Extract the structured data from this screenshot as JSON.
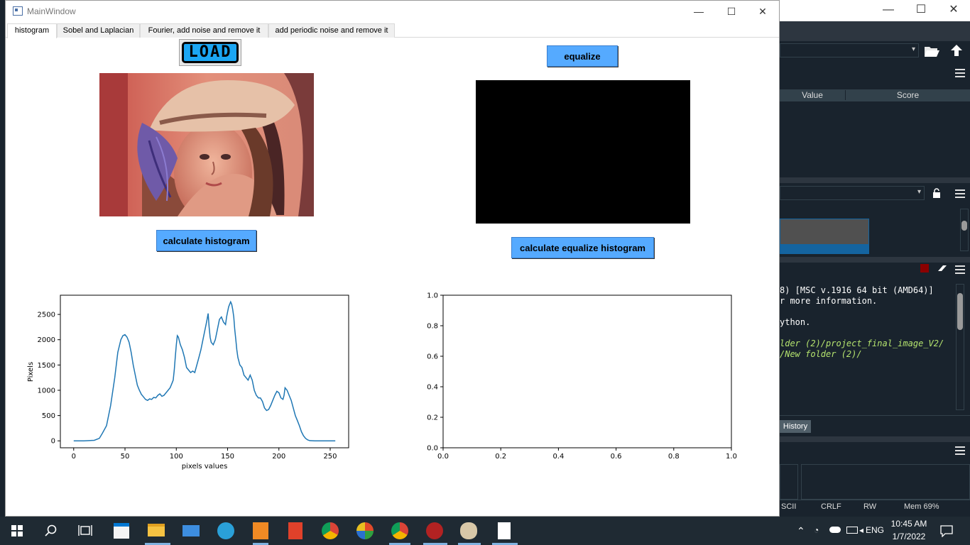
{
  "window": {
    "title": "MainWindow",
    "minimize": "—",
    "maximize": "☐",
    "close": "✕"
  },
  "tabs": [
    {
      "label": "histogram",
      "active": true
    },
    {
      "label": "Sobel and Laplacian",
      "active": false
    },
    {
      "label": "Fourier, add noise and remove it",
      "active": false
    },
    {
      "label": "add periodic noise and remove it",
      "active": false
    }
  ],
  "buttons": {
    "load": "LOAD",
    "equalize": "equalize",
    "calculate_histogram": "calculate histogram",
    "calculate_equalize_histogram": "calculate equalize histogram"
  },
  "colors": {
    "button_blue": "#55aaff",
    "line": "#1f77b4"
  },
  "chart_data": [
    {
      "type": "line",
      "title": "",
      "xlabel": "pixels values",
      "ylabel": "Pixels",
      "xlim": [
        -13,
        268
      ],
      "ylim": [
        -137,
        2880
      ],
      "xticks": [
        0,
        50,
        100,
        150,
        200,
        250
      ],
      "yticks": [
        0,
        500,
        1000,
        1500,
        2000,
        2500
      ],
      "grid": false,
      "series": [
        {
          "x": [
            0,
            10,
            20,
            25,
            28,
            32,
            36,
            40,
            43,
            46,
            48,
            50,
            52,
            54,
            56,
            58,
            60,
            62,
            64,
            66,
            68,
            70,
            72,
            74,
            76,
            78,
            80,
            82,
            84,
            86,
            88,
            90,
            92,
            94,
            96,
            97,
            98,
            99,
            100,
            101,
            102,
            104,
            106,
            108,
            110,
            112,
            114,
            116,
            118,
            120,
            122,
            124,
            126,
            128,
            129,
            130,
            131,
            132,
            133,
            134,
            136,
            138,
            140,
            142,
            144,
            146,
            148,
            149,
            150,
            151,
            152,
            153,
            154,
            155,
            156,
            157,
            158,
            159,
            160,
            162,
            164,
            166,
            168,
            170,
            172,
            174,
            176,
            178,
            180,
            182,
            184,
            186,
            188,
            190,
            192,
            194,
            196,
            198,
            200,
            202,
            204,
            205,
            206,
            208,
            210,
            212,
            214,
            216,
            218,
            220,
            222,
            224,
            226,
            228,
            230,
            235,
            240,
            245,
            250,
            255
          ],
          "y": [
            0,
            0,
            10,
            50,
            150,
            300,
            700,
            1250,
            1750,
            2000,
            2080,
            2100,
            2050,
            1950,
            1750,
            1500,
            1300,
            1100,
            1000,
            920,
            870,
            820,
            800,
            830,
            820,
            860,
            850,
            900,
            930,
            880,
            900,
            950,
            1000,
            1050,
            1150,
            1200,
            1400,
            1650,
            1900,
            2080,
            2050,
            1900,
            1800,
            1650,
            1450,
            1400,
            1350,
            1380,
            1350,
            1500,
            1650,
            1800,
            2000,
            2200,
            2300,
            2400,
            2520,
            2250,
            2050,
            1950,
            1900,
            2000,
            2200,
            2400,
            2450,
            2350,
            2300,
            2450,
            2550,
            2650,
            2700,
            2750,
            2700,
            2600,
            2450,
            2200,
            2000,
            1800,
            1650,
            1500,
            1450,
            1300,
            1250,
            1200,
            1300,
            1200,
            1000,
            900,
            850,
            850,
            780,
            650,
            600,
            620,
            700,
            800,
            900,
            980,
            950,
            850,
            820,
            900,
            1050,
            1000,
            900,
            800,
            650,
            500,
            400,
            300,
            180,
            100,
            50,
            20,
            5,
            0,
            0,
            0,
            0,
            0
          ]
        }
      ]
    },
    {
      "type": "line",
      "title": "",
      "xlabel": "",
      "ylabel": "",
      "xlim": [
        0,
        1
      ],
      "ylim": [
        0,
        1
      ],
      "xticks": [
        "0.0",
        "0.2",
        "0.4",
        "0.6",
        "0.8",
        "1.0"
      ],
      "yticks": [
        "0.0",
        "0.2",
        "0.4",
        "0.6",
        "0.8",
        "1.0"
      ],
      "grid": false,
      "series": []
    }
  ],
  "ide": {
    "var_columns": [
      "Value",
      "Score"
    ],
    "console_lines": [
      "8) [MSC v.1916 64 bit (AMD64)]",
      "r more information.",
      "ython.",
      "lder (2)/project_final_image_V2/",
      "/New folder (2)/"
    ],
    "history_tab": "History",
    "status": [
      "SCII",
      "CRLF",
      "RW",
      "Mem 69%"
    ]
  },
  "taskbar": {
    "time": "10:45 AM",
    "date": "1/7/2022",
    "lang": "ENG"
  }
}
